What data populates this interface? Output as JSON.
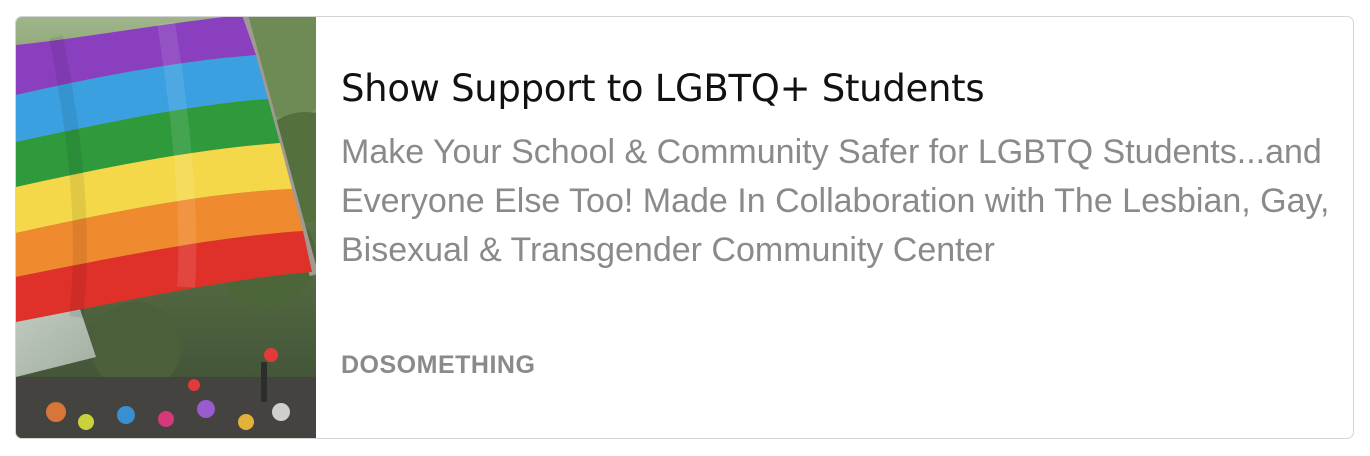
{
  "card": {
    "image_alt": "Rainbow pride flag",
    "title": "Show Support to LGBTQ+ Students",
    "description": "Make Your School & Community Safer for LGBTQ Students...and Everyone Else Too! Made In Collaboration with The Lesbian, Gay, Bisexual & Transgender Community Center",
    "source": "DOSOMETHING"
  },
  "colors": {
    "title": "#111111",
    "muted_text": "#8a8a8a",
    "border": "#d4d4d4",
    "flag_purple": "#8a3fbf",
    "flag_blue": "#3aa0e0",
    "flag_green": "#2f9a3c",
    "flag_yellow": "#f4d84a",
    "flag_orange": "#f08a2e",
    "flag_red": "#e0302a"
  }
}
